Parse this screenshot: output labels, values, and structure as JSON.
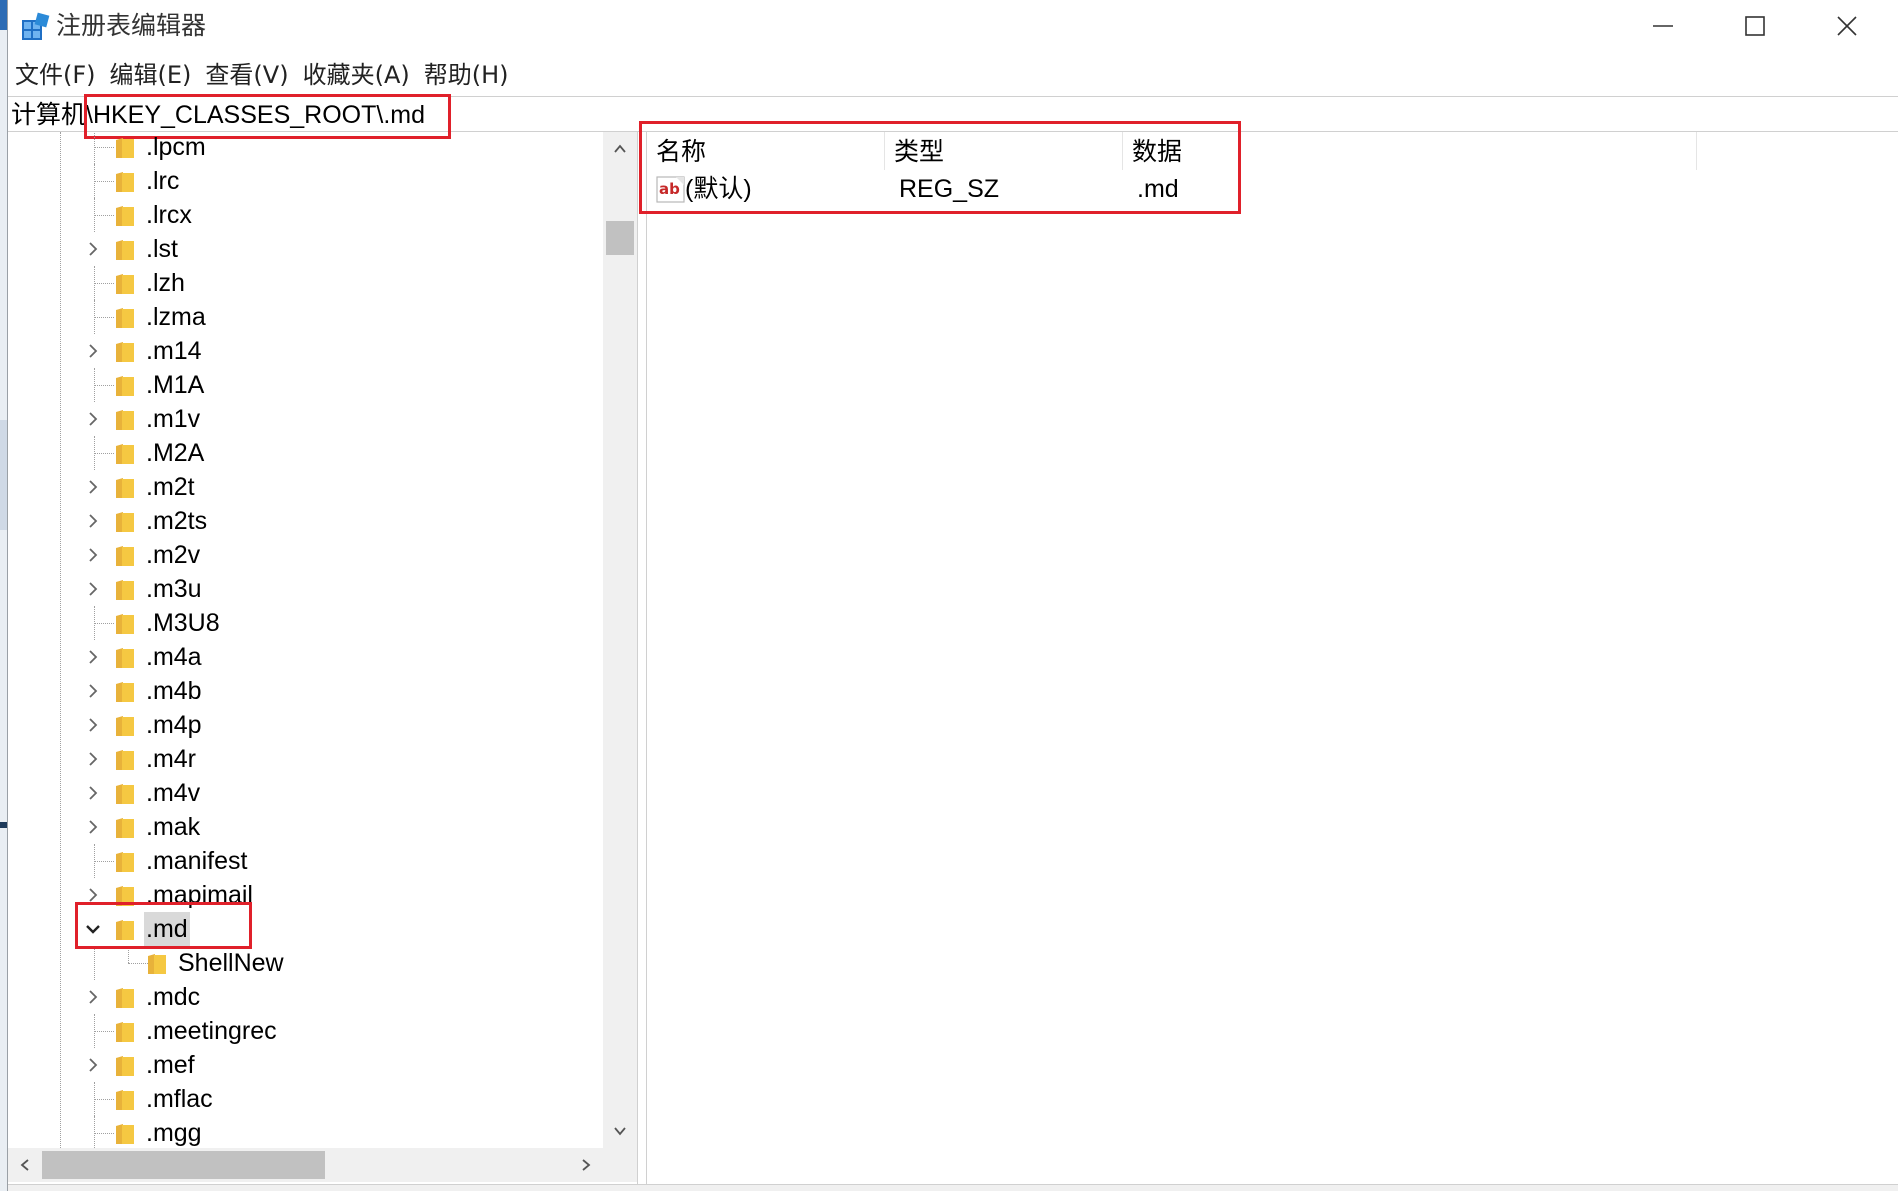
{
  "window": {
    "title": "注册表编辑器"
  },
  "menubar": {
    "items": [
      "文件(F)",
      "编辑(E)",
      "查看(V)",
      "收藏夹(A)",
      "帮助(H)"
    ]
  },
  "address": {
    "path": "计算机\\HKEY_CLASSES_ROOT\\.md"
  },
  "tree": {
    "items": [
      {
        "label": ".lpcm",
        "expandable": false
      },
      {
        "label": ".lrc",
        "expandable": false
      },
      {
        "label": ".lrcx",
        "expandable": false
      },
      {
        "label": ".lst",
        "expandable": true
      },
      {
        "label": ".lzh",
        "expandable": false
      },
      {
        "label": ".lzma",
        "expandable": false
      },
      {
        "label": ".m14",
        "expandable": true
      },
      {
        "label": ".M1A",
        "expandable": false
      },
      {
        "label": ".m1v",
        "expandable": true
      },
      {
        "label": ".M2A",
        "expandable": false
      },
      {
        "label": ".m2t",
        "expandable": true
      },
      {
        "label": ".m2ts",
        "expandable": true
      },
      {
        "label": ".m2v",
        "expandable": true
      },
      {
        "label": ".m3u",
        "expandable": true
      },
      {
        "label": ".M3U8",
        "expandable": false
      },
      {
        "label": ".m4a",
        "expandable": true
      },
      {
        "label": ".m4b",
        "expandable": true
      },
      {
        "label": ".m4p",
        "expandable": true
      },
      {
        "label": ".m4r",
        "expandable": true
      },
      {
        "label": ".m4v",
        "expandable": true
      },
      {
        "label": ".mak",
        "expandable": true
      },
      {
        "label": ".manifest",
        "expandable": false
      },
      {
        "label": ".mapimail",
        "expandable": true
      },
      {
        "label": ".md",
        "expandable": true,
        "expanded": true,
        "selected": true
      },
      {
        "label": "ShellNew",
        "child": true
      },
      {
        "label": ".mdc",
        "expandable": true
      },
      {
        "label": ".meetingrec",
        "expandable": false
      },
      {
        "label": ".mef",
        "expandable": true
      },
      {
        "label": ".mflac",
        "expandable": false
      },
      {
        "label": ".mgg",
        "expandable": false
      }
    ]
  },
  "list": {
    "columns": [
      "名称",
      "类型",
      "数据"
    ],
    "rows": [
      {
        "name": "(默认)",
        "type": "REG_SZ",
        "data": ".md",
        "icon": "string-value-icon"
      }
    ]
  },
  "colors": {
    "annotation_red": "#e0202a",
    "folder_yellow": "#f5c842",
    "selection_gray": "#d9d9d9"
  }
}
